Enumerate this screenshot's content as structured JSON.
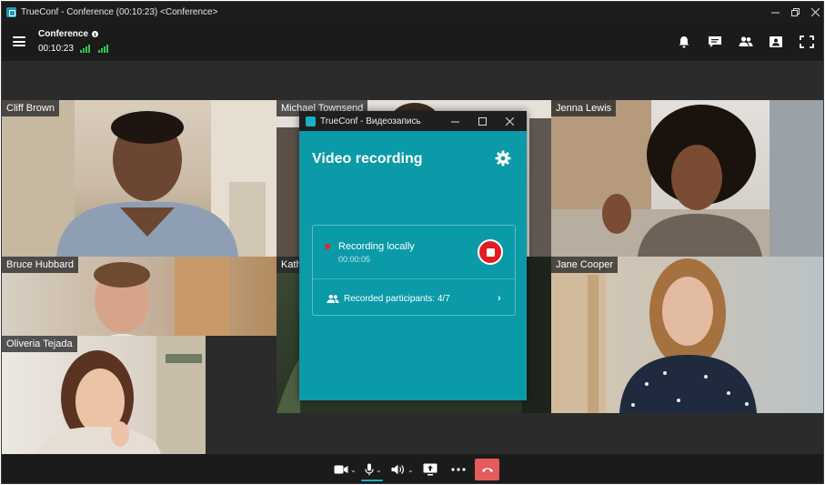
{
  "window": {
    "title": "TrueConf - Conference (00:10:23) <Conference>",
    "controls": [
      "minimize",
      "maximize",
      "close"
    ]
  },
  "header": {
    "conference_name": "Conference",
    "elapsed_time": "00:10:23",
    "icons": [
      "menu-icon",
      "info-icon",
      "signal-icon",
      "notifications-icon",
      "chat-icon",
      "participants-icon",
      "content-icon",
      "fullscreen-icon"
    ]
  },
  "participants": [
    {
      "name": "Cliff Brown"
    },
    {
      "name": "Michael Townsend"
    },
    {
      "name": "Jenna Lewis"
    },
    {
      "name": "Bruce Hubbard"
    },
    {
      "name": "Kath"
    },
    {
      "name": "Jane Cooper"
    },
    {
      "name": "Oliveria Tejada"
    }
  ],
  "recording_dialog": {
    "window_title": "TrueConf - Видеозапись",
    "heading": "Video recording",
    "status_label": "Recording locally",
    "duration": "00:00:05",
    "participants_label": "Recorded participants: 4/7"
  },
  "toolbar": {
    "buttons": [
      "camera",
      "microphone",
      "speaker",
      "share-screen",
      "more",
      "hang-up"
    ]
  },
  "colors": {
    "accent": "#0a9aa8",
    "record": "#e21c24",
    "hangup": "#e45b5b",
    "signal": "#35c553"
  }
}
